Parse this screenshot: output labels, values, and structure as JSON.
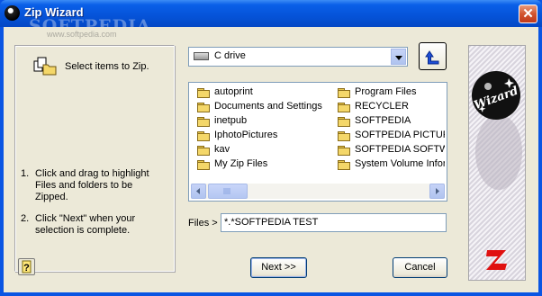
{
  "window": {
    "title": "Zip Wizard",
    "close_glyph": "✕"
  },
  "watermark": {
    "brand": "SOFTPEDIA",
    "url": "www.softpedia.com"
  },
  "left_panel": {
    "select_label": "Select items to Zip.",
    "instructions": [
      {
        "num": "1.",
        "text": "Click and drag to highlight Files and folders to be Zipped."
      },
      {
        "num": "2.",
        "text": "Click \"Next\" when your selection is complete."
      }
    ],
    "help_icon": "question-icon"
  },
  "drive_select": {
    "value": "C drive",
    "icon": "hard-drive-icon"
  },
  "up_button": {
    "icon": "up-folder-icon"
  },
  "files": {
    "col1": [
      "autoprint",
      "Documents and Settings",
      "inetpub",
      "IphotoPictures",
      "kav",
      "My Zip Files"
    ],
    "col2": [
      "Program Files",
      "RECYCLER",
      "SOFTPEDIA",
      "SOFTPEDIA PICTURES",
      "SOFTPEDIA SOFTWARE",
      "System Volume Information"
    ]
  },
  "files_field": {
    "label": "Files >",
    "value": "*.*SOFTPEDIA TEST"
  },
  "buttons": {
    "next": "Next >>",
    "cancel": "Cancel"
  },
  "sidebar": {
    "logo_text": "Wizard",
    "logo_icon": "wizard-ball-icon",
    "z_icon": "zip-z-icon"
  },
  "colors": {
    "title_bar": "#0553d8",
    "face": "#ece9d8",
    "folder": "#f4d769",
    "z_logo": "#e01010"
  }
}
